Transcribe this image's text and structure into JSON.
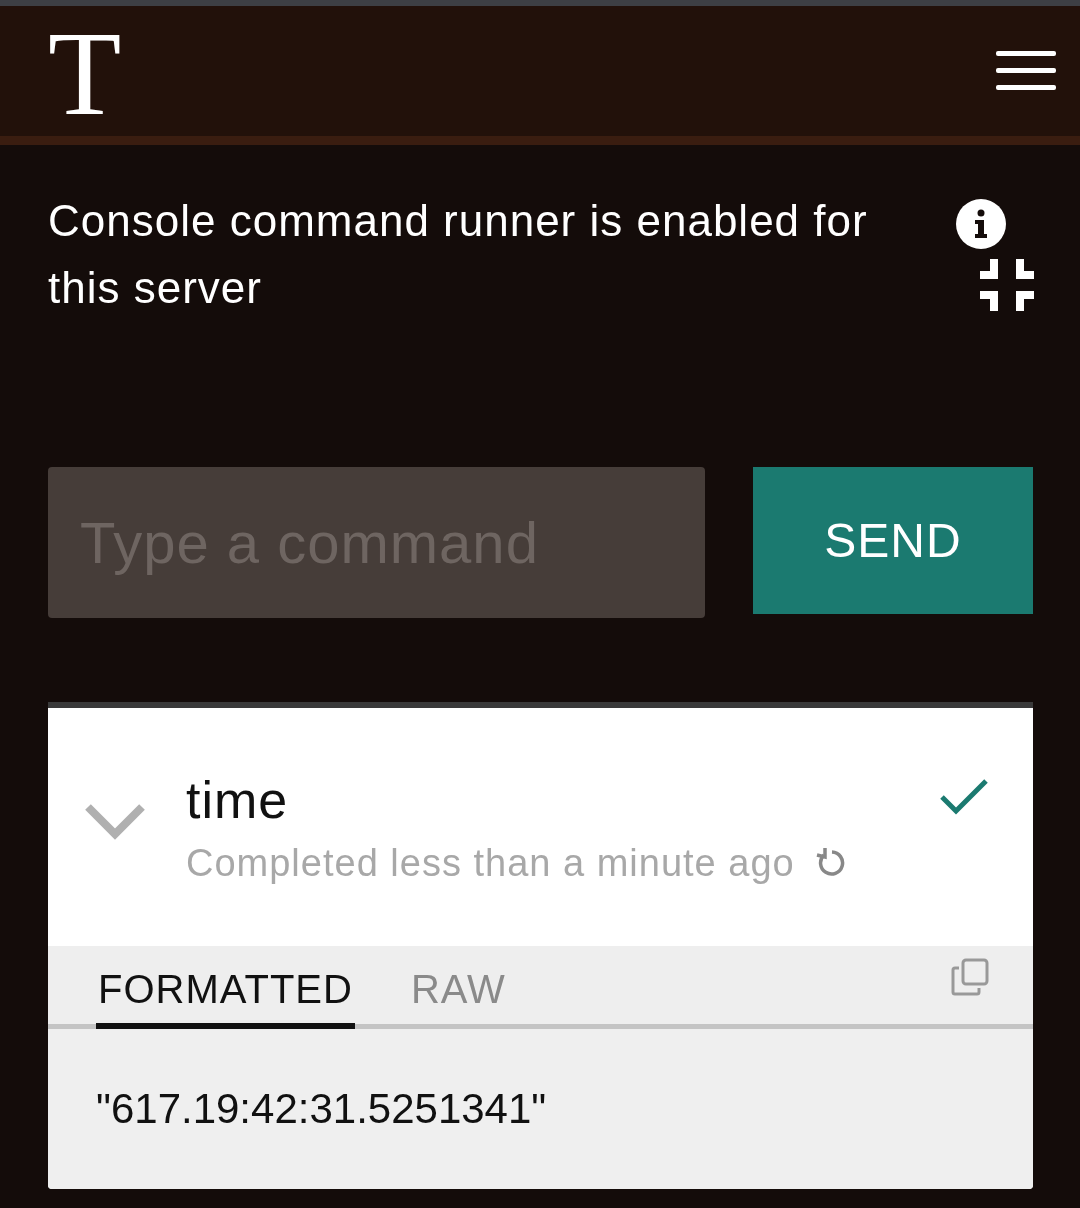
{
  "header": {
    "logo": "T"
  },
  "notice": {
    "text": "Console command runner is enabled for this server"
  },
  "command": {
    "placeholder": "Type a command",
    "send_label": "SEND"
  },
  "result": {
    "command": "time",
    "expanded": true,
    "status": "Completed less than a minute ago",
    "success": true,
    "tabs": [
      {
        "label": "FORMATTED",
        "selected": true
      },
      {
        "label": "RAW",
        "selected": false
      }
    ],
    "output": "\"617.19:42:31.5251341\""
  }
}
